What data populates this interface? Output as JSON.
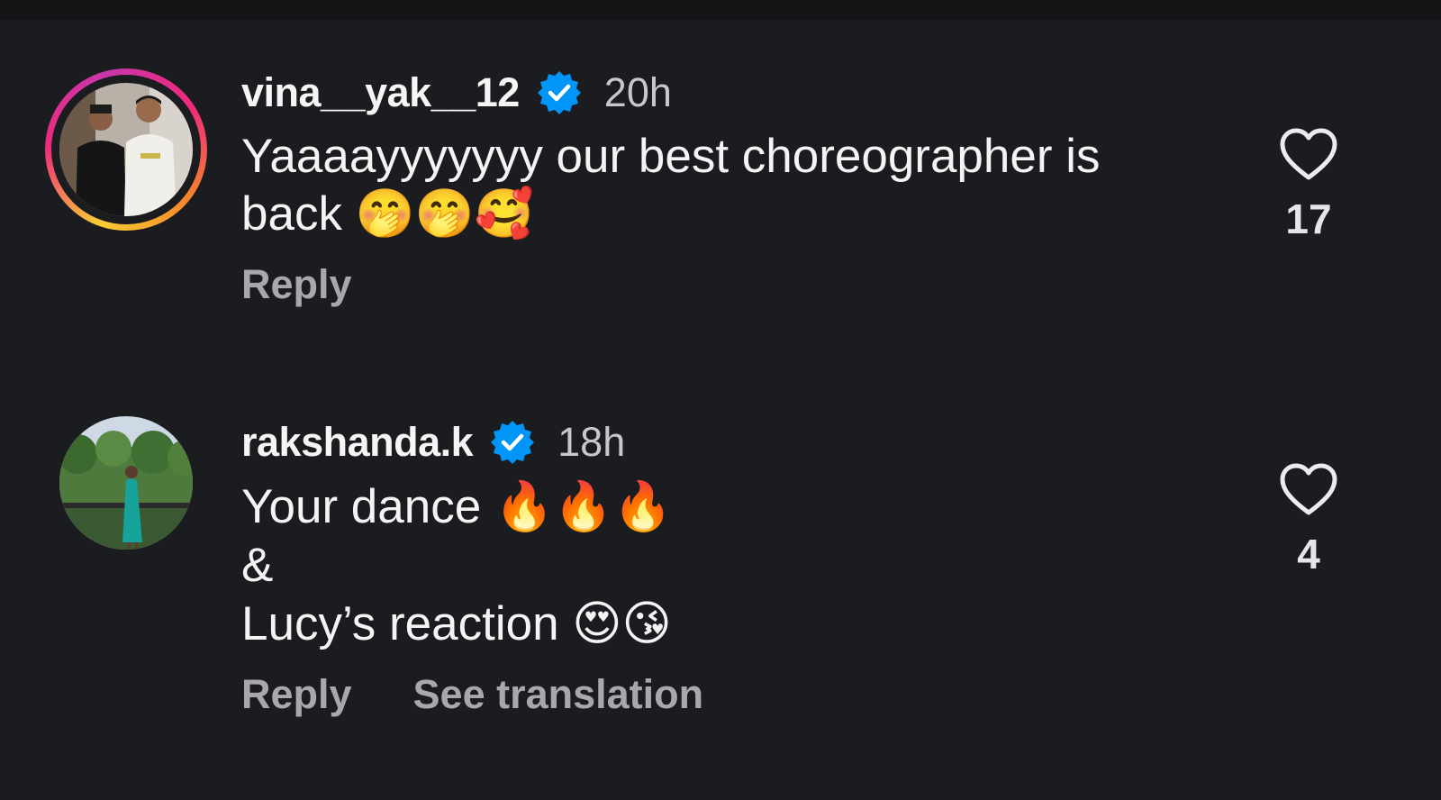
{
  "comments": [
    {
      "username": "vina__yak__12",
      "verified": true,
      "time": "20h",
      "text": "Yaaaayyyyyyy our best choreographer is\nback 🤭🤭🥰",
      "actions": [
        "Reply"
      ],
      "likes": "17",
      "avatar_ring": "story-gradient"
    },
    {
      "username": "rakshanda.k",
      "verified": true,
      "time": "18h",
      "text": "Your dance 🔥🔥🔥\n&\nLucy’s reaction 😍😘",
      "actions": [
        "Reply",
        "See translation"
      ],
      "likes": "4"
    }
  ],
  "icons": {
    "verified": "verified-badge-icon",
    "like": "heart-outline-icon"
  },
  "colors": {
    "background": "#1a1c1f",
    "verified": "#0095f6",
    "secondary_text": "#a6a8ad"
  }
}
